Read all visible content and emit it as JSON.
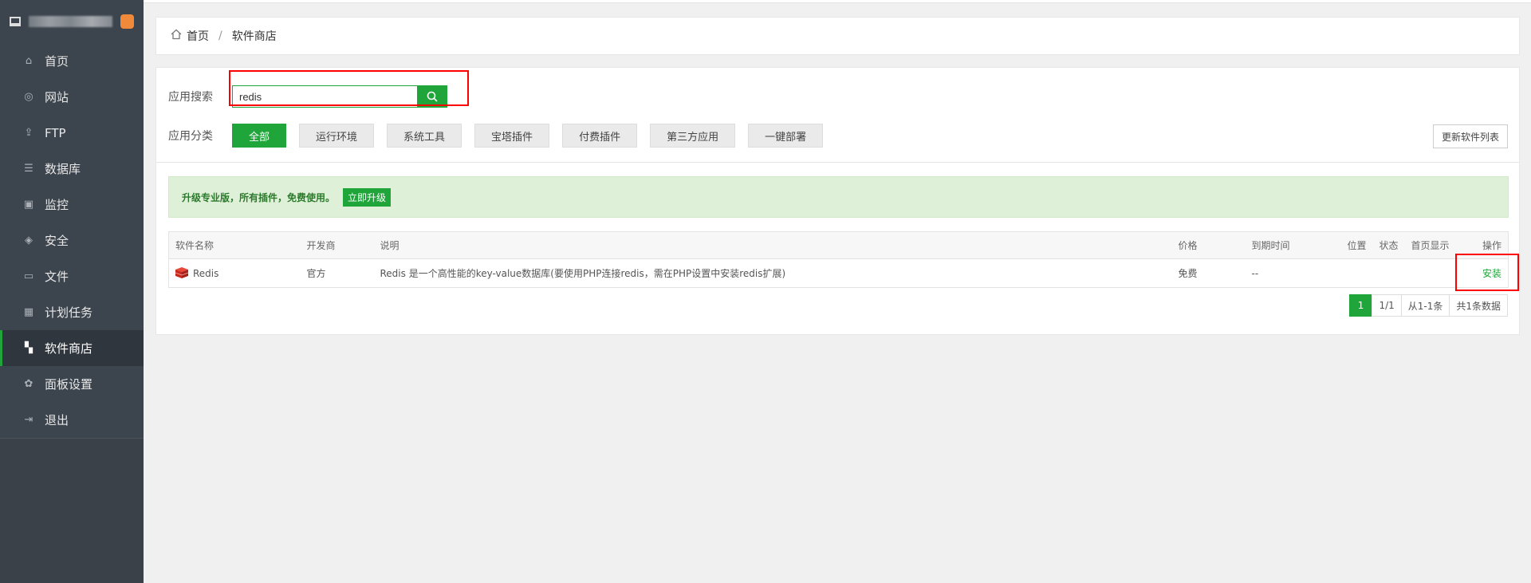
{
  "sidebar": {
    "items": [
      {
        "label": "首页",
        "icon": "home-icon",
        "glyph": "⌂"
      },
      {
        "label": "网站",
        "icon": "globe-icon",
        "glyph": "◎"
      },
      {
        "label": "FTP",
        "icon": "ftp-icon",
        "glyph": "⇪"
      },
      {
        "label": "数据库",
        "icon": "database-icon",
        "glyph": "☰"
      },
      {
        "label": "监控",
        "icon": "monitor-icon",
        "glyph": "▣"
      },
      {
        "label": "安全",
        "icon": "shield-icon",
        "glyph": "◈"
      },
      {
        "label": "文件",
        "icon": "folder-icon",
        "glyph": "▭"
      },
      {
        "label": "计划任务",
        "icon": "calendar-icon",
        "glyph": "▦"
      },
      {
        "label": "软件商店",
        "icon": "apps-icon",
        "glyph": "▚",
        "active": true
      },
      {
        "label": "面板设置",
        "icon": "gear-icon",
        "glyph": "✿"
      },
      {
        "label": "退出",
        "icon": "logout-icon",
        "glyph": "⇥"
      }
    ],
    "add_symbol": "+"
  },
  "breadcrumb": {
    "home": "首页",
    "separator": "/",
    "current": "软件商店"
  },
  "search": {
    "label": "应用搜索",
    "value": "redis"
  },
  "categories": {
    "label": "应用分类",
    "items": [
      "全部",
      "运行环境",
      "系统工具",
      "宝塔插件",
      "付费插件",
      "第三方应用",
      "一键部署"
    ],
    "active_index": 0
  },
  "refresh_label": "更新软件列表",
  "promo": {
    "text": "升级专业版，所有插件，免费使用。",
    "button": "立即升级"
  },
  "table": {
    "headers": [
      "软件名称",
      "开发商",
      "说明",
      "价格",
      "到期时间",
      "位置",
      "状态",
      "首页显示",
      "操作"
    ],
    "rows": [
      {
        "name": "Redis",
        "developer": "官方",
        "description": "Redis 是一个高性能的key-value数据库(要使用PHP连接redis，需在PHP设置中安装redis扩展)",
        "price": "免费",
        "expire": "--",
        "location": "",
        "status": "",
        "home_display": "",
        "action": "安装"
      }
    ]
  },
  "pager": {
    "current": "1",
    "pages": "1/1",
    "range": "从1-1条",
    "total": "共1条数据"
  },
  "colors": {
    "accent": "#20a53a",
    "sidebar_bg": "#3c444d",
    "highlight": "#ff0000"
  }
}
